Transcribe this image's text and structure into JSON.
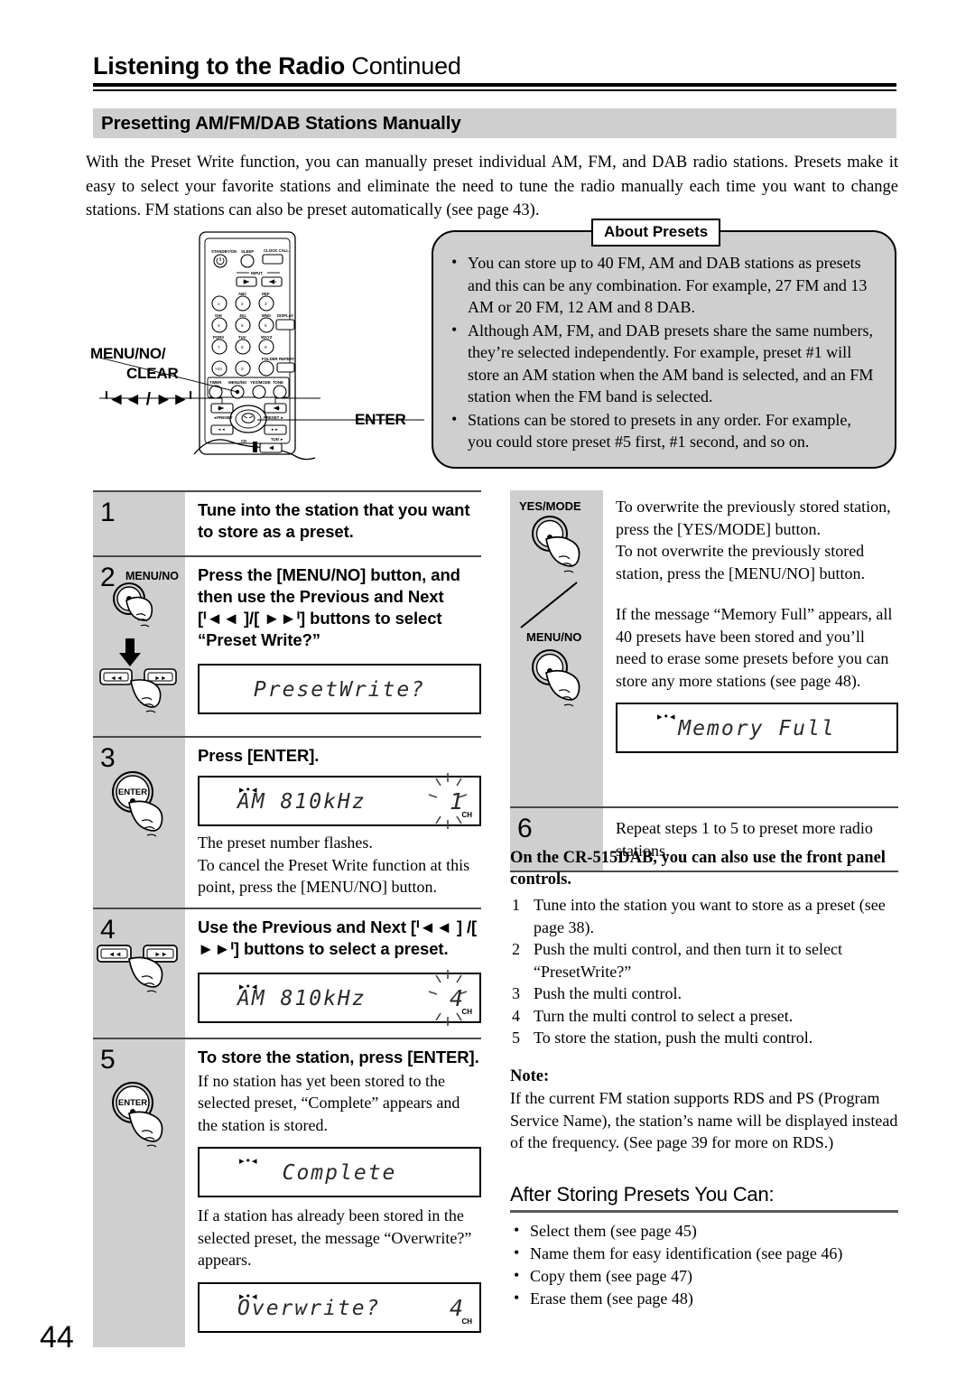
{
  "header": {
    "title_bold": "Listening to the Radio",
    "title_cont": "Continued",
    "section": "Presetting AM/FM/DAB Stations Manually"
  },
  "intro": "With the Preset Write function, you can manually preset individual AM, FM, and DAB radio stations. Presets make it easy to select your favorite stations and eliminate the need to tune the radio manually each time you want to change stations. FM stations can also be preset automatically (see page 43).",
  "about": {
    "title": "About Presets",
    "items": [
      "You can store up to 40 FM, AM and DAB stations as presets and this can be any combination. For example, 27 FM and 13 AM or 20 FM, 12 AM and 8 DAB.",
      "Although AM, FM, and DAB presets share the same numbers, they’re selected independently. For example, preset #1 will store an AM station when the AM band is selected, and an FM station when the FM band is selected.",
      "Stations can be stored to presets in any order. For example, you could store preset #5 first, #1 second, and so on."
    ]
  },
  "remote": {
    "label_menu": "MENU/NO/",
    "label_clear": "CLEAR",
    "label_prevnext": "ᑊ◄◄ / ►►ᑊ",
    "label_enter": "ENTER",
    "keys": {
      "standby": "STANDBY/ON",
      "sleep": "SLEEP",
      "clock_call": "CLOCK CALL",
      "input": "INPUT",
      "display": "DISPLAY",
      "repeat": "REPEAT",
      "folder": "FOLDER",
      "timer": "TIMER",
      "menuno": "MENU/NO",
      "yesmode": "YES/MODE",
      "tone": "TONE",
      "preset_left": "◄ PRESET",
      "preset_right": "PRESET ►",
      "tun": "TUN ►",
      "cd": "CD",
      "num_abc": "ABC",
      "num_def": "DEF",
      "num_ghi": "GHI",
      "num_jkl": "JKL",
      "num_mno": "MNO",
      "num_pqrs": "PQRS",
      "num_tuv": "TUV",
      "num_wxyz": "WXYZ",
      "num_1": "1",
      "num_2": "2",
      "num_3": "3",
      "num_4": "4",
      "num_5": "5",
      "num_6": "6",
      "num_7": "7",
      "num_8": "8",
      "num_9": "9",
      "num_0": "0",
      "num_10": ">10"
    }
  },
  "steps": [
    {
      "num": "1",
      "heading": "Tune into the station that you want to store as a preset."
    },
    {
      "num": "2",
      "button_label": "MENU/NO",
      "heading": "Press the [MENU/NO] button, and then use the Previous and Next [ᑊ◄◄ ]/[ ►►ᑊ] buttons to select “Preset Write?”",
      "lcd": {
        "text": "PresetWrite?",
        "dots": false,
        "preset": "",
        "flash": false
      }
    },
    {
      "num": "3",
      "button_label": "ENTER",
      "heading": "Press [ENTER].",
      "lcd": {
        "text": "AM     810kHz",
        "dots": true,
        "preset": "1",
        "ch": "CH",
        "flash": true
      },
      "body": "The preset number flashes.\nTo cancel the Preset Write function at this point, press the [MENU/NO] button."
    },
    {
      "num": "4",
      "heading": "Use the Previous and Next [ᑊ◄◄ ] /[ ►►ᑊ] buttons to select a preset.",
      "lcd": {
        "text": "AM     810kHz",
        "dots": true,
        "preset": "4",
        "ch": "CH",
        "flash": true
      }
    },
    {
      "num": "5",
      "button_label": "ENTER",
      "heading": "To store the station, press [ENTER].",
      "body1": "If no station has yet been stored to the selected preset, “Complete” appears and the station is stored.",
      "lcd1": {
        "text": "Complete",
        "dots": true
      },
      "body2": "If a station has already been stored in the selected preset, the message “Overwrite?” appears.",
      "lcd2": {
        "text": "Overwrite?",
        "dots": true,
        "preset": "4",
        "ch": "CH"
      }
    }
  ],
  "right": {
    "buttons": {
      "yesmode": "YES/MODE",
      "menuno": "MENU/NO"
    },
    "overwrite_text": "To overwrite the previously stored station, press the [YES/MODE] button.\nTo not overwrite the previously stored station, press the [MENU/NO] button.",
    "memory_text": "If the message “Memory Full” appears, all 40 presets have been stored and you’ll need to erase some presets before you can store any more stations (see page 48).",
    "lcd_memory": {
      "text": "Memory Full",
      "dots": true
    },
    "step6": {
      "num": "6",
      "text": "Repeat steps 1 to 5 to preset more radio stations."
    },
    "frontpanel": {
      "heading": "On the CR-515DAB, you can also use the front panel controls.",
      "items": [
        {
          "n": "1",
          "t": "Tune into the station you want to store as a preset (see page 38)."
        },
        {
          "n": "2",
          "t": "Push the multi control, and then turn it to select “PresetWrite?”"
        },
        {
          "n": "3",
          "t": "Push the multi control."
        },
        {
          "n": "4",
          "t": "Turn the multi control to select a preset."
        },
        {
          "n": "5",
          "t": "To store the station, push the multi control."
        }
      ]
    },
    "note": {
      "label": "Note:",
      "text": "If the current FM station supports RDS and PS (Program Service Name), the station’s name will be displayed instead of the frequency. (See page 39 for more on RDS.)"
    },
    "after": {
      "title": "After Storing Presets You Can:",
      "items": [
        "Select them (see page 45)",
        "Name them for easy identification (see page 46)",
        "Copy them (see page 47)",
        "Erase them (see page 48)"
      ]
    }
  },
  "page_number": "44"
}
